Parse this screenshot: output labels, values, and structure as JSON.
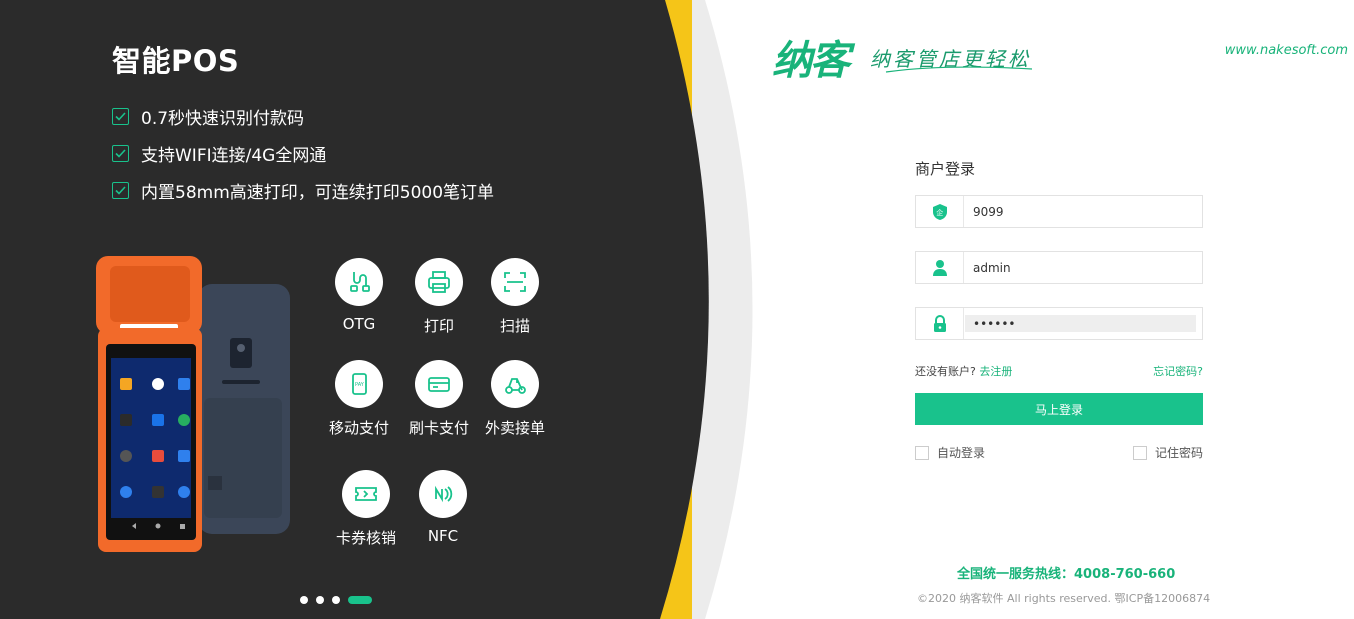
{
  "promo": {
    "title": "智能POS",
    "features": [
      "0.7秒快速识别付款码",
      "支持WIFI连接/4G全网通",
      "内置58mm高速打印，可连续打印5000笔订单"
    ],
    "functions": [
      {
        "label": "OTG",
        "icon": "usb-cable-icon"
      },
      {
        "label": "打印",
        "icon": "printer-icon"
      },
      {
        "label": "扫描",
        "icon": "scan-icon"
      },
      {
        "label": "移动支付",
        "icon": "mobile-pay-icon"
      },
      {
        "label": "刷卡支付",
        "icon": "card-pay-icon"
      },
      {
        "label": "外卖接单",
        "icon": "delivery-icon"
      },
      {
        "label": "卡券核销",
        "icon": "coupon-icon"
      },
      {
        "label": "NFC",
        "icon": "nfc-icon"
      }
    ],
    "carousel": {
      "count": 4,
      "active_index": 3
    }
  },
  "brand": {
    "logo": "纳客",
    "slogan": "纳客管店更轻松",
    "url": "www.nakesoft.com"
  },
  "login": {
    "title": "商户登录",
    "merchant_value": "9099",
    "username_value": "admin",
    "password_value": "••••••",
    "no_account_text": "还没有账户?",
    "register_link": "去注册",
    "forgot_link": "忘记密码?",
    "submit_label": "马上登录",
    "auto_login_label": "自动登录",
    "remember_password_label": "记住密码"
  },
  "footer": {
    "hotline_label": "全国统一服务热线：",
    "hotline_number": "4008-760-660",
    "copyright": "©2020 纳客软件 All rights reserved. 鄂ICP备12006874"
  },
  "colors": {
    "accent": "#19c28c",
    "dark_panel": "#2b2b2b",
    "yellow_arc": "#f5c518",
    "light_arc": "#ececec"
  }
}
